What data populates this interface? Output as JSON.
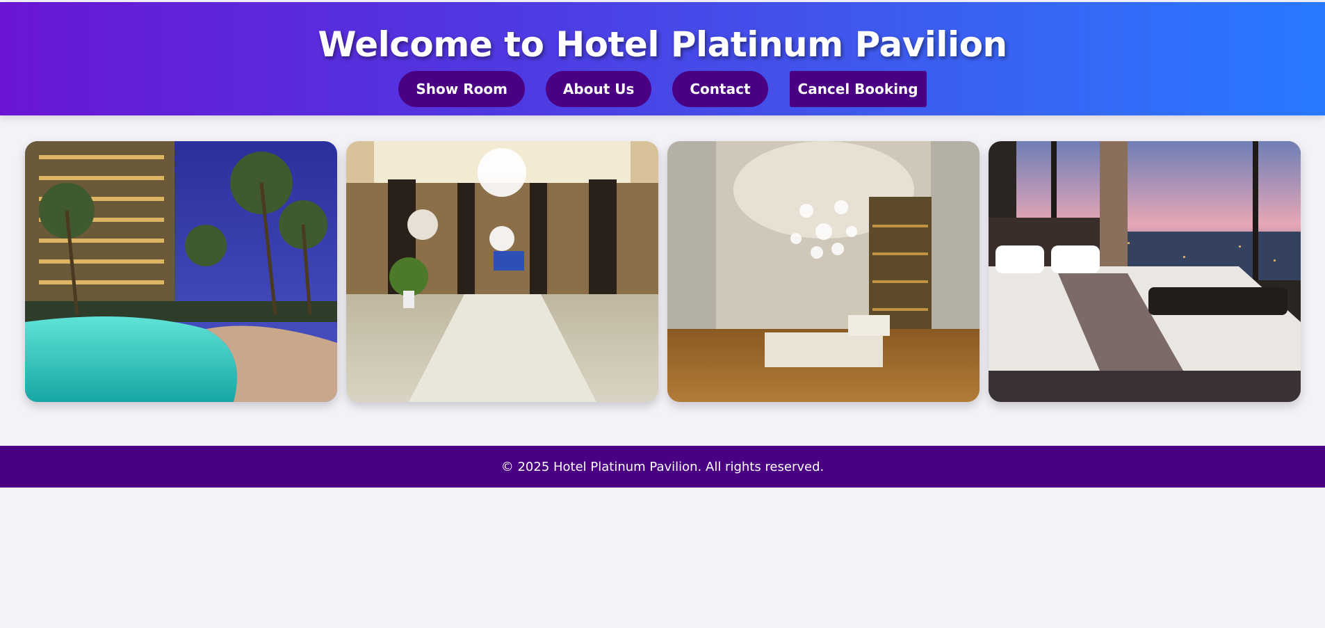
{
  "header": {
    "title": "Welcome to Hotel Platinum Pavilion",
    "nav": [
      {
        "label": "Show Room"
      },
      {
        "label": "About Us"
      },
      {
        "label": "Contact"
      },
      {
        "label": "Cancel Booking"
      }
    ]
  },
  "gallery": {
    "images": [
      {
        "icon": "pool-image"
      },
      {
        "icon": "lobby-image"
      },
      {
        "icon": "lounge-image"
      },
      {
        "icon": "bedroom-image"
      }
    ]
  },
  "footer": {
    "text": "© 2025 Hotel Platinum Pavilion. All rights reserved."
  },
  "colors": {
    "header_gradient_start": "#6a16d3",
    "header_gradient_end": "#2979ff",
    "button_bg": "#4a0082",
    "footer_bg": "#4a0082",
    "page_bg": "#f3f2f8"
  }
}
